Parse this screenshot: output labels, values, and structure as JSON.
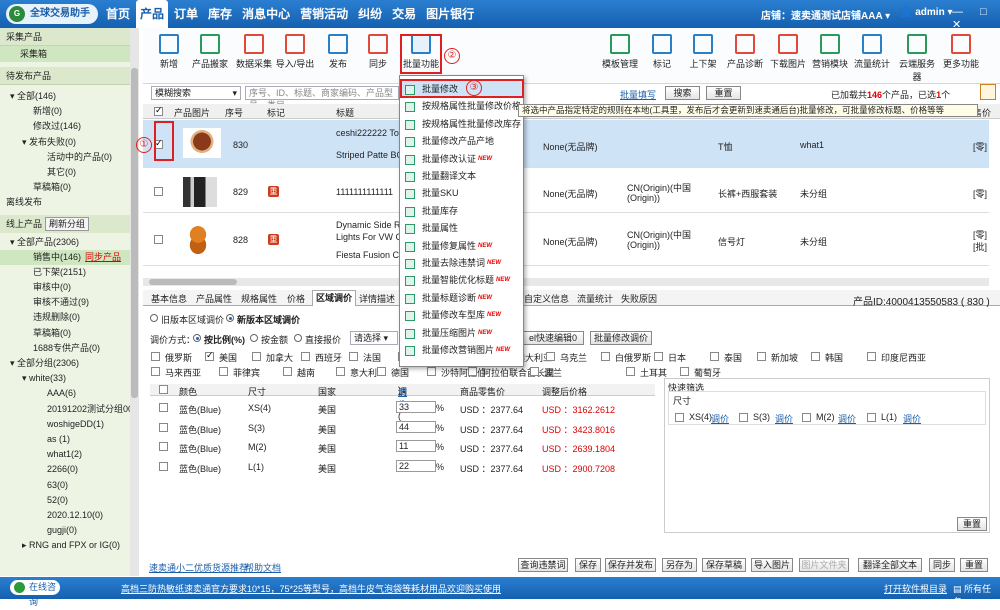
{
  "app": {
    "logo": "全球交易助手",
    "logo_mark": "G",
    "store_label": "店铺：",
    "store_name": "速卖通测试店铺AAA",
    "admin": "admin",
    "winbtns": "— □ ✕"
  },
  "nav": [
    "首页",
    "产品",
    "订单",
    "库存",
    "消息中心",
    "营销活动",
    "纠纷",
    "交易",
    "图片银行"
  ],
  "sidebar": {
    "collect_header": "采集产品",
    "collect_item": "采集箱",
    "pending_header": "待发布产品",
    "pending": [
      "全部(146)",
      "新增(0)",
      "修改过(146)",
      "发布失败(0)",
      "活动中的产品(0)",
      "其它(0)",
      "草稿箱(0)"
    ],
    "offline": "离线发布",
    "online_header": "线上产品",
    "refresh": "刷新分组",
    "online": [
      "全部产品(2306)",
      "销售中(146)",
      "已下架(2151)",
      "审核中(0)",
      "审核不通过(9)",
      "违规删除(0)",
      "草稿箱(0)",
      "1688专供产品(0)"
    ],
    "sync": "同步产品",
    "groups_header": "全部分组(2306)",
    "groups": [
      "white(33)",
      "AAA(6)",
      "20191202测试分组001",
      "woshigeDD(1)",
      "as (1)",
      "what1(2)",
      "2266(0)",
      "63(0)",
      "52(0)",
      "2020.12.10(0)",
      "gugji(0)",
      "RNG and FPX or IG(0)"
    ]
  },
  "toolbar": {
    "left": [
      "新增",
      "产品搬家",
      "数据采集",
      "导入/导出",
      "发布",
      "同步",
      "批量功能"
    ],
    "right": [
      "模板管理",
      "标记",
      "上下架",
      "产品诊断",
      "下载图片",
      "营销模块",
      "流量统计",
      "云端服务器",
      "更多功能"
    ]
  },
  "annotations": [
    "①",
    "②",
    "③"
  ],
  "search": {
    "mode": "模糊搜索",
    "placeholder": "序号、ID、标题、商家编码、产品型号、类目",
    "fill": "批量填写",
    "search_btn": "搜索",
    "reset_btn": "重置",
    "total_pre": "已加载共",
    "total_count": "146",
    "total_mid": "个产品，已选",
    "selected": "1",
    "total_suf": "个"
  },
  "table": {
    "headers": [
      "产品图片",
      "序号",
      "标记",
      "标题"
    ],
    "right_header": "售价",
    "rows": [
      {
        "seq": "830",
        "title1": "ceshi222222 Toy",
        "title2": "Striped Patte BO",
        "brand": "None(无品牌)",
        "origin1": "",
        "origin2": "",
        "type": "T恤",
        "group": "what1",
        "tail": "[零]"
      },
      {
        "seq": "829",
        "title1": "1111111111111",
        "title2": "",
        "brand": "None(无品牌)",
        "origin1": "CN(Origin)(中国",
        "origin2": "(Origin))",
        "type": "长裤+西服套装",
        "group": "未分组",
        "tail": "[零]"
      },
      {
        "seq": "828",
        "title1": "Dynamic Side R",
        "title2": "Lights For VW G",
        "title3": "Fiesta Fusion C-",
        "brand": "None(无品牌)",
        "origin1": "CN(Origin)(中国",
        "origin2": "(Origin))",
        "type": "信号灯",
        "group": "未分组",
        "tail": "[零]",
        "tail2": "[批]"
      }
    ],
    "mark_badge": "重"
  },
  "dropdown": [
    {
      "label": "批量修改",
      "new": false
    },
    {
      "label": "按规格属性批量修改价格",
      "new": false
    },
    {
      "label": "按规格属性批量修改库存",
      "new": false
    },
    {
      "label": "批量修改产品产地",
      "new": false
    },
    {
      "label": "批量修改认证",
      "new": true
    },
    {
      "label": "批量翻译文本",
      "new": false
    },
    {
      "label": "批量SKU",
      "new": false
    },
    {
      "label": "批量库存",
      "new": false
    },
    {
      "label": "批量属性",
      "new": false
    },
    {
      "label": "批量修复属性",
      "new": true
    },
    {
      "label": "批量去除违禁词",
      "new": true
    },
    {
      "label": "批量智能优化标题",
      "new": true
    },
    {
      "label": "批量标题诊断",
      "new": true
    },
    {
      "label": "批量修改车型库",
      "new": true
    },
    {
      "label": "批量压缩图片",
      "new": true
    },
    {
      "label": "批量修改营销图片",
      "new": true
    }
  ],
  "new_tag": "NEW",
  "tooltip": "将选中产品指定特定的规则在本地(工具里，发布后才会更新到速卖通后台)批量修改，可批量修改标题、价格等等",
  "tabs": [
    "基本信息",
    "产品属性",
    "规格属性",
    "价格",
    "区域调价",
    "详情描述",
    "自定义信息",
    "流量统计",
    "失败原因"
  ],
  "product_id_label": "产品ID:",
  "product_id": "4000413550583 ( 830 )",
  "region": {
    "old": "旧版本区域调价",
    "new": "新版本区域调价",
    "method_label": "调价方式：",
    "methods": [
      "按比例(%)",
      "按金额",
      "直接报价"
    ],
    "select": "请选择",
    "quick_edit": "el快速编辑0",
    "batch_price": "批量修改调价",
    "countries": [
      "俄罗斯",
      "美国",
      "加拿大",
      "西班牙",
      "法国",
      "巴西",
      "智利",
      "澳大利亚",
      "乌克兰",
      "白俄罗斯",
      "日本",
      "泰国",
      "新加坡",
      "韩国",
      "印度尼西亚",
      "马来西亚",
      "菲律宾",
      "越南",
      "意大利",
      "德国",
      "沙特阿拉伯",
      "阿拉伯联合酋长国",
      "波兰",
      "土耳其",
      "葡萄牙"
    ]
  },
  "grid": {
    "headers": [
      "颜色",
      "尺寸",
      "国家",
      "调价(",
      "清空",
      ")",
      "商品零售价",
      "调整后价格"
    ],
    "rows": [
      {
        "color": "蓝色(Blue)",
        "size": "XS(4)",
        "country": "美国",
        "pct": "33",
        "retail": "USD ：2377.64",
        "adjusted": "USD ：3162.2612"
      },
      {
        "color": "蓝色(Blue)",
        "size": "S(3)",
        "country": "美国",
        "pct": "44",
        "retail": "USD ：2377.64",
        "adjusted": "USD ：3423.8016"
      },
      {
        "color": "蓝色(Blue)",
        "size": "M(2)",
        "country": "美国",
        "pct": "11",
        "retail": "USD ：2377.64",
        "adjusted": "USD ：2639.1804"
      },
      {
        "color": "蓝色(Blue)",
        "size": "L(1)",
        "country": "美国",
        "pct": "22",
        "retail": "USD ：2377.64",
        "adjusted": "USD ：2900.7208"
      }
    ],
    "pct_sign": "%"
  },
  "quick": {
    "title": "快速筛选",
    "size_label": "尺寸",
    "items": [
      "XS(4)",
      "S(3)",
      "M(2)",
      "L(1)"
    ],
    "adjust": "调价",
    "reset": "重置"
  },
  "bottom": {
    "links": [
      "速卖通小二优质货源推荐",
      "帮助文档"
    ],
    "buttons": [
      "查询违禁词",
      "保存",
      "保存并发布",
      "另存为",
      "保存草稿",
      "导入图片",
      "图片文件夹",
      "翻译全部文本",
      "同步",
      "重置"
    ]
  },
  "status": {
    "online": "在线咨询",
    "ad": "高档三防热敏纸速卖通官方要求10*15，75*25等型号，高档牛皮气泡袋等耗材用品欢迎购买使用",
    "log": "打开软件根目录",
    "msg": "所有任务"
  }
}
